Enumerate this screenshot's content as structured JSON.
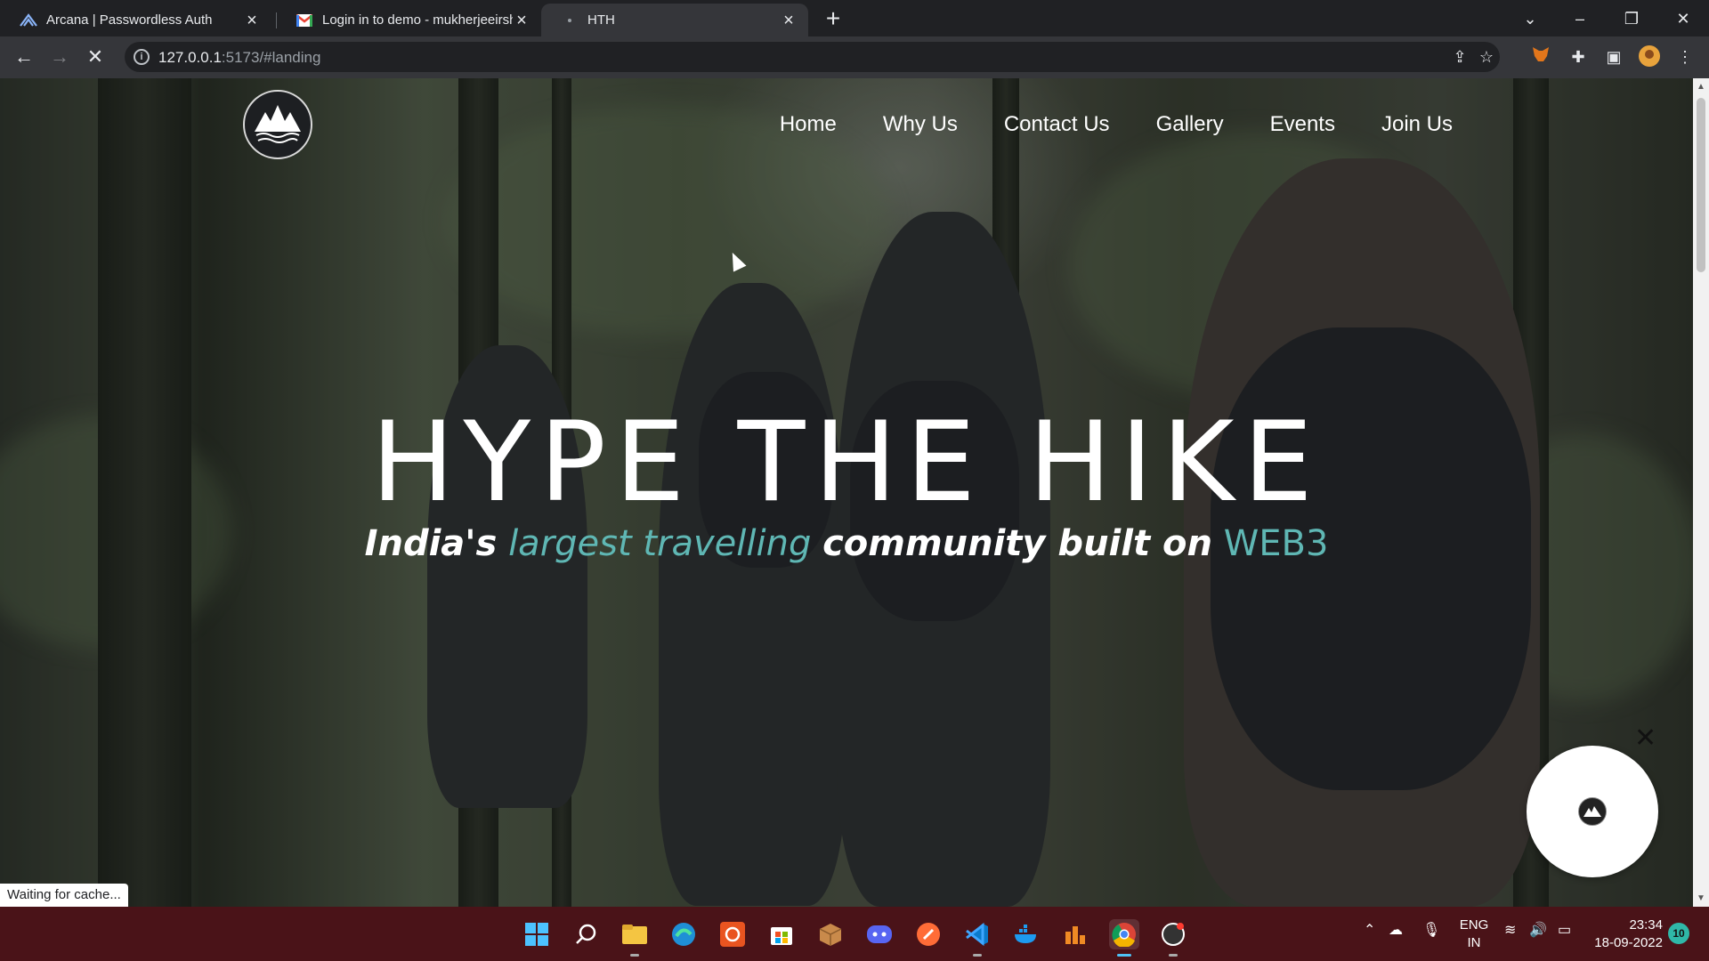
{
  "browser": {
    "tabs": [
      {
        "title": "Arcana | Passwordless Auth",
        "icon": "arcana-icon",
        "active": false
      },
      {
        "title": "Login in to demo - mukherjeeirsh",
        "icon": "gmail-icon",
        "active": false
      },
      {
        "title": "HTH",
        "icon": "loading-dot-icon",
        "active": true
      }
    ],
    "url_host": "127.0.0.1",
    "url_path": ":5173/#landing",
    "status_text": "Waiting for cache..."
  },
  "site": {
    "nav": [
      "Home",
      "Why Us",
      "Contact Us",
      "Gallery",
      "Events",
      "Join Us"
    ],
    "hero_title": "HYPE THE HIKE",
    "subtitle": {
      "part1": "India's",
      "part2": "largest travelling",
      "part3": "community built on",
      "part4": "WEB3"
    },
    "accent_color": "#5fb7b4"
  },
  "taskbar": {
    "lang_top": "ENG",
    "lang_bottom": "IN",
    "time": "23:34",
    "date": "18-09-2022",
    "notification_count": "10"
  }
}
